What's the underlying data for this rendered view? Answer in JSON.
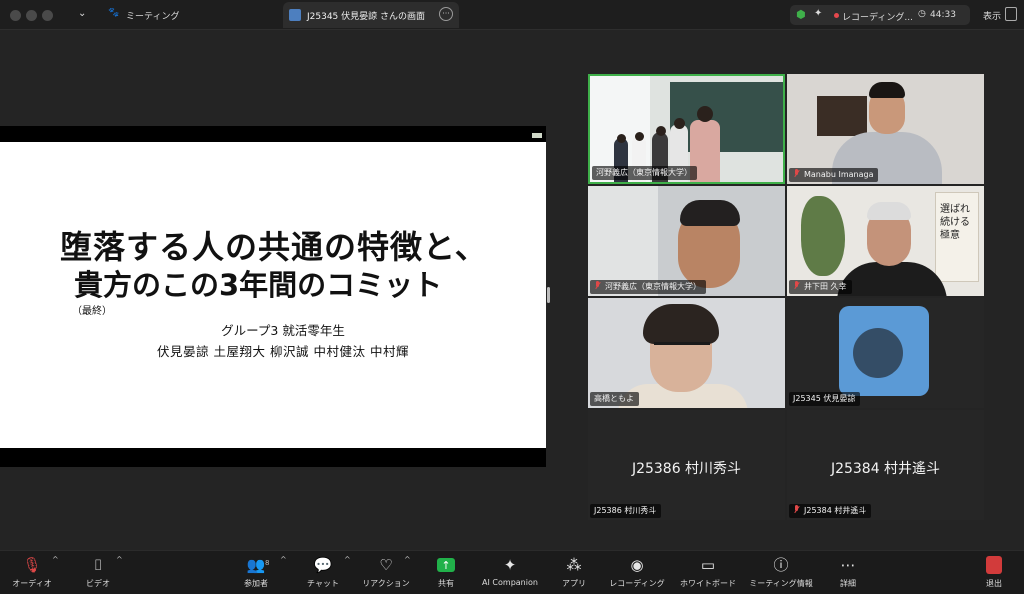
{
  "titlebar": {
    "meeting_label": "ミーティング",
    "tab_label": "J25345 伏見晏諒 さんの画面",
    "recording_label": "レコーディング...",
    "timer": "44:33",
    "view_label": "表示"
  },
  "slide": {
    "title_line1": "堕落する人の共通の特徴と、",
    "title_line2": "貴方のこの3年間のコミット",
    "note": "（最終）",
    "group": "グループ3 就活零年生",
    "members": "伏見晏諒  土屋翔大  柳沢誠  中村健汰  中村輝"
  },
  "participants": [
    {
      "name": "河野義広（東京情報大学）",
      "muted": false,
      "active_speaker": true
    },
    {
      "name": "Manabu Imanaga",
      "muted": true
    },
    {
      "name": "河野義広（東京情報大学）",
      "muted": true
    },
    {
      "name": "井下田 久幸",
      "muted": true
    },
    {
      "name": "高橋ともよ",
      "muted": false
    },
    {
      "name": "J25345 伏見晏諒",
      "muted": false
    },
    {
      "name": "J25386 村川秀斗",
      "muted": false,
      "display_text": "J25386 村川秀斗"
    },
    {
      "name": "J25384 村井遙斗",
      "muted": true,
      "display_text": "J25384 村井遙斗"
    }
  ],
  "tile4_book_text": "選ばれ続ける極意",
  "toolbar": {
    "audio": "オーディオ",
    "video": "ビデオ",
    "participants": "参加者",
    "participants_count": "8",
    "chat": "チャット",
    "reaction": "リアクション",
    "share": "共有",
    "ai": "AI Companion",
    "apps": "アプリ",
    "record": "レコーディング",
    "whiteboard": "ホワイトボード",
    "meeting_info": "ミーティング情報",
    "more": "詳細",
    "leave": "退出"
  },
  "colors": {
    "active_speaker_border": "#3fb04a",
    "share_button": "#21b14a",
    "muted_icon": "#e04848",
    "recording_dot": "#e5484d"
  }
}
